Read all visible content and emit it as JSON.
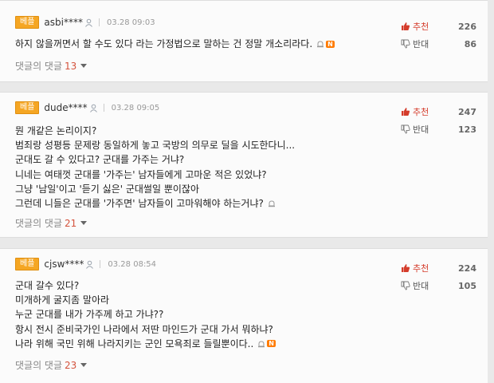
{
  "comments": [
    {
      "badge": "베플",
      "nick": "asbi****",
      "time": "03.28 09:03",
      "upvote_label": "추천",
      "upvotes": "226",
      "downvote_label": "반대",
      "downvotes": "86",
      "lines": [
        "하지 않을꺼면서 할 수도 있다 라는 가정법으로 말하는 건 정말 개소리라다."
      ],
      "replies_label": "댓글의 댓글",
      "replies_count": "13",
      "new_badge": "N"
    },
    {
      "badge": "베플",
      "nick": "dude****",
      "time": "03.28 09:05",
      "upvote_label": "추천",
      "upvotes": "247",
      "downvote_label": "반대",
      "downvotes": "123",
      "lines": [
        "뭔 개같은 논리이지?",
        "범죄랑 성평등 문제랑 동일하게 놓고 국방의 의무로 딜을 시도한다니...",
        "군대도 갈 수 있다고? 군대를 가주는 거냐?",
        "니네는 여태껏 군대를 '가주는' 남자들에게 고마운 적은 있었냐?",
        "그냥 '남일'이고 '듣기 싫은' 군대썰일 뿐이잖아",
        "그런데 니들은 군대를 '가주면' 남자들이 고마워해야 하는거냐?"
      ],
      "replies_label": "댓글의 댓글",
      "replies_count": "21",
      "new_badge": ""
    },
    {
      "badge": "베플",
      "nick": "cjsw****",
      "time": "03.28 08:54",
      "upvote_label": "추천",
      "upvotes": "224",
      "downvote_label": "반대",
      "downvotes": "105",
      "lines": [
        "군대 갈수 있다?",
        "미개하게 굴지좀 말아라",
        "누군 군대를 내가 가주께 하고 가냐??",
        "항시 전시 준비국가인 나라에서 저딴 마인드가 군대 가서 뭐하냐?",
        "나라 위해 국민 위해 나라지키는 군인 모욕죄로 들릴뿐이다.."
      ],
      "replies_label": "댓글의 댓글",
      "replies_count": "23",
      "new_badge": "N"
    }
  ],
  "colors": {
    "badge": "#f5a623",
    "upvote": "#d43c2b",
    "reply_count": "#d4533d",
    "new": "#ff7b00"
  }
}
